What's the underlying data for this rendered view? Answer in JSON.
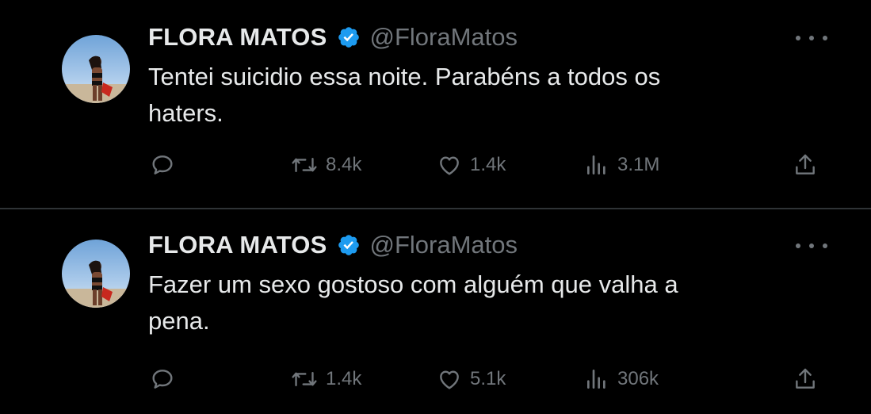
{
  "tweets": [
    {
      "author": {
        "name": "FLORA MATOS",
        "handle": "@FloraMatos",
        "verified_icon": "verified-badge-icon"
      },
      "text_lines": [
        "Tentei suicidio essa noite. Parabéns a todos os",
        "haters."
      ],
      "stats": {
        "retweets": "8.4k",
        "likes": "1.4k",
        "views": "3.1M"
      }
    },
    {
      "author": {
        "name": "FLORA MATOS",
        "handle": "@FloraMatos",
        "verified_icon": "verified-badge-icon"
      },
      "text_lines": [
        "Fazer um sexo gostoso com alguém que valha a",
        "pena."
      ],
      "stats": {
        "retweets": "1.4k",
        "likes": "5.1k",
        "views": "306k"
      }
    }
  ],
  "colors": {
    "background": "#000000",
    "text_primary": "#e7e9ea",
    "text_secondary": "#71767b",
    "verified_blue": "#1d9bf0",
    "divider": "#2f3336"
  },
  "icons": [
    "reply-icon",
    "retweet-icon",
    "like-icon",
    "views-icon",
    "share-icon",
    "more-options-icon"
  ]
}
